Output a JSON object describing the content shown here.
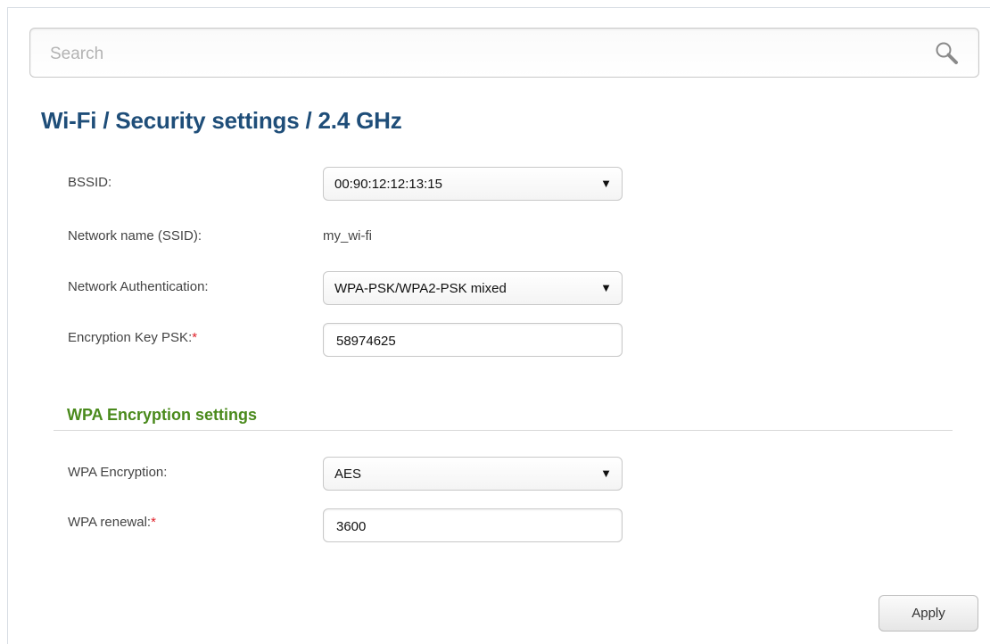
{
  "search": {
    "placeholder": "Search",
    "icon": "search-icon"
  },
  "breadcrumb": {
    "title": "Wi-Fi /  Security settings /  2.4 GHz"
  },
  "form": {
    "bssid": {
      "label": "BSSID:",
      "value": "00:90:12:12:13:15"
    },
    "ssid": {
      "label": "Network name (SSID):",
      "value": "my_wi-fi"
    },
    "auth": {
      "label": "Network Authentication:",
      "value": "WPA-PSK/WPA2-PSK mixed"
    },
    "psk": {
      "label": "Encryption Key PSK:",
      "required_mark": "*",
      "value": "58974625"
    }
  },
  "wpa_section": {
    "title": "WPA Encryption settings",
    "encryption": {
      "label": "WPA Encryption:",
      "value": "AES"
    },
    "renewal": {
      "label": "WPA renewal:",
      "required_mark": "*",
      "value": "3600"
    }
  },
  "actions": {
    "apply_label": "Apply"
  },
  "colors": {
    "title": "#1f4e79",
    "section_title": "#4a8a1c",
    "required": "#e0212b"
  },
  "select_arrow": "▼"
}
